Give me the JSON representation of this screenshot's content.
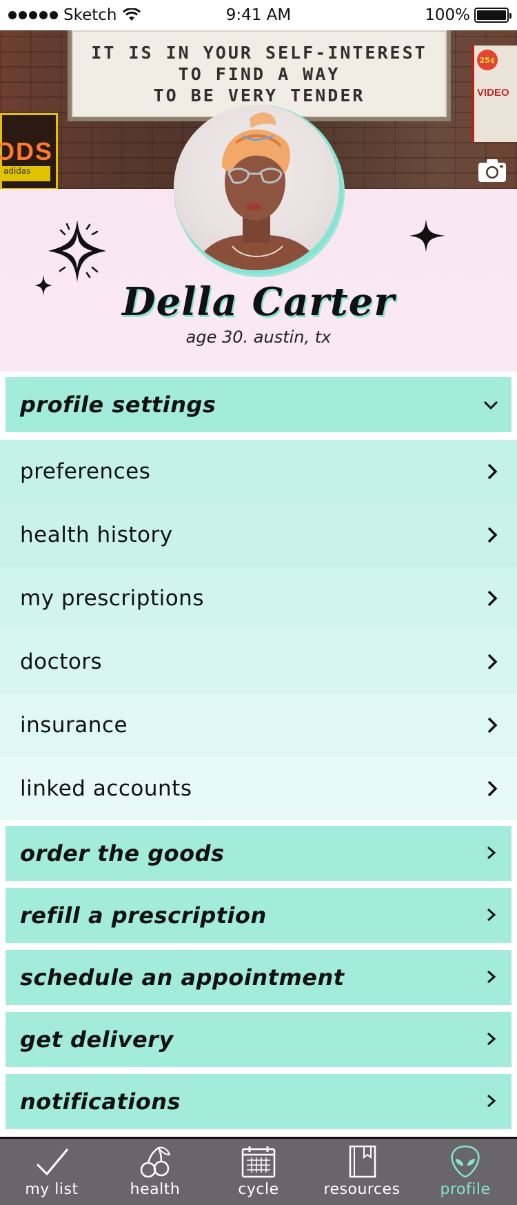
{
  "status_bar": {
    "carrier": "Sketch",
    "time": "9:41 AM",
    "battery": "100%"
  },
  "header": {
    "marquee_lines": [
      "IT IS IN YOUR SELF-INTEREST",
      "TO FIND A WAY",
      "TO BE VERY TENDER"
    ],
    "left_sign_text": "ODS",
    "left_sub_text": "adidas",
    "right_sign_badge": "25¢",
    "right_sign_text": "VIDEO"
  },
  "profile": {
    "name": "Della Carter",
    "subtitle": "age 30. austin, tx"
  },
  "menu": {
    "profile_settings": "profile settings",
    "sub_items": [
      "preferences",
      "health history",
      "my prescriptions",
      "doctors",
      "insurance",
      "linked accounts"
    ],
    "sections": [
      "order the goods",
      "refill a prescription",
      "schedule an appointment",
      "get delivery",
      "notifications"
    ]
  },
  "tabs": [
    {
      "label": "my list",
      "icon": "check-icon"
    },
    {
      "label": "health",
      "icon": "cherry-icon"
    },
    {
      "label": "cycle",
      "icon": "calendar-icon"
    },
    {
      "label": "resources",
      "icon": "book-icon"
    },
    {
      "label": "profile",
      "icon": "alien-icon",
      "active": true
    }
  ],
  "colors": {
    "mint": "#a3ecdc",
    "mint_light": "#e8f9f5",
    "pink": "#f9e8f1",
    "tabbar": "#69666a",
    "accent": "#88e3d3"
  }
}
